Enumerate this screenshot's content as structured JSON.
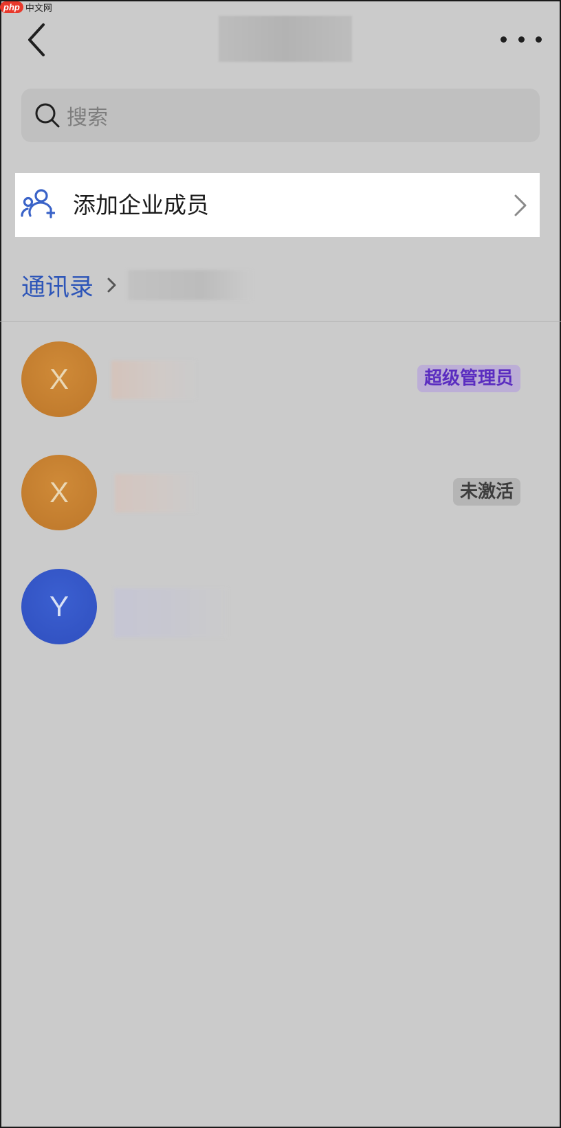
{
  "watermark": {
    "logo": "php",
    "text": "中文网"
  },
  "header": {
    "title": "",
    "back_icon": "chevron-left-icon",
    "more_icon": "more-dots-icon"
  },
  "search": {
    "placeholder": "搜索",
    "icon": "search-icon"
  },
  "add_member": {
    "label": "添加企业成员",
    "icon": "add-user-icon",
    "accent_color": "#3a63c8"
  },
  "breadcrumb": {
    "root": "通讯录",
    "current": ""
  },
  "members": [
    {
      "initial": "X",
      "name": "",
      "badge": "超级管理员",
      "avatar_color": "#c77f31"
    },
    {
      "initial": "X",
      "name": "",
      "badge": "未激活",
      "avatar_color": "#c77f31"
    },
    {
      "initial": "Y",
      "name": "",
      "badge": "",
      "avatar_color": "#3455c6"
    }
  ],
  "colors": {
    "background": "#cbcbcb",
    "link_blue": "#2d55b8",
    "admin_badge_text": "#5a2cc0"
  }
}
